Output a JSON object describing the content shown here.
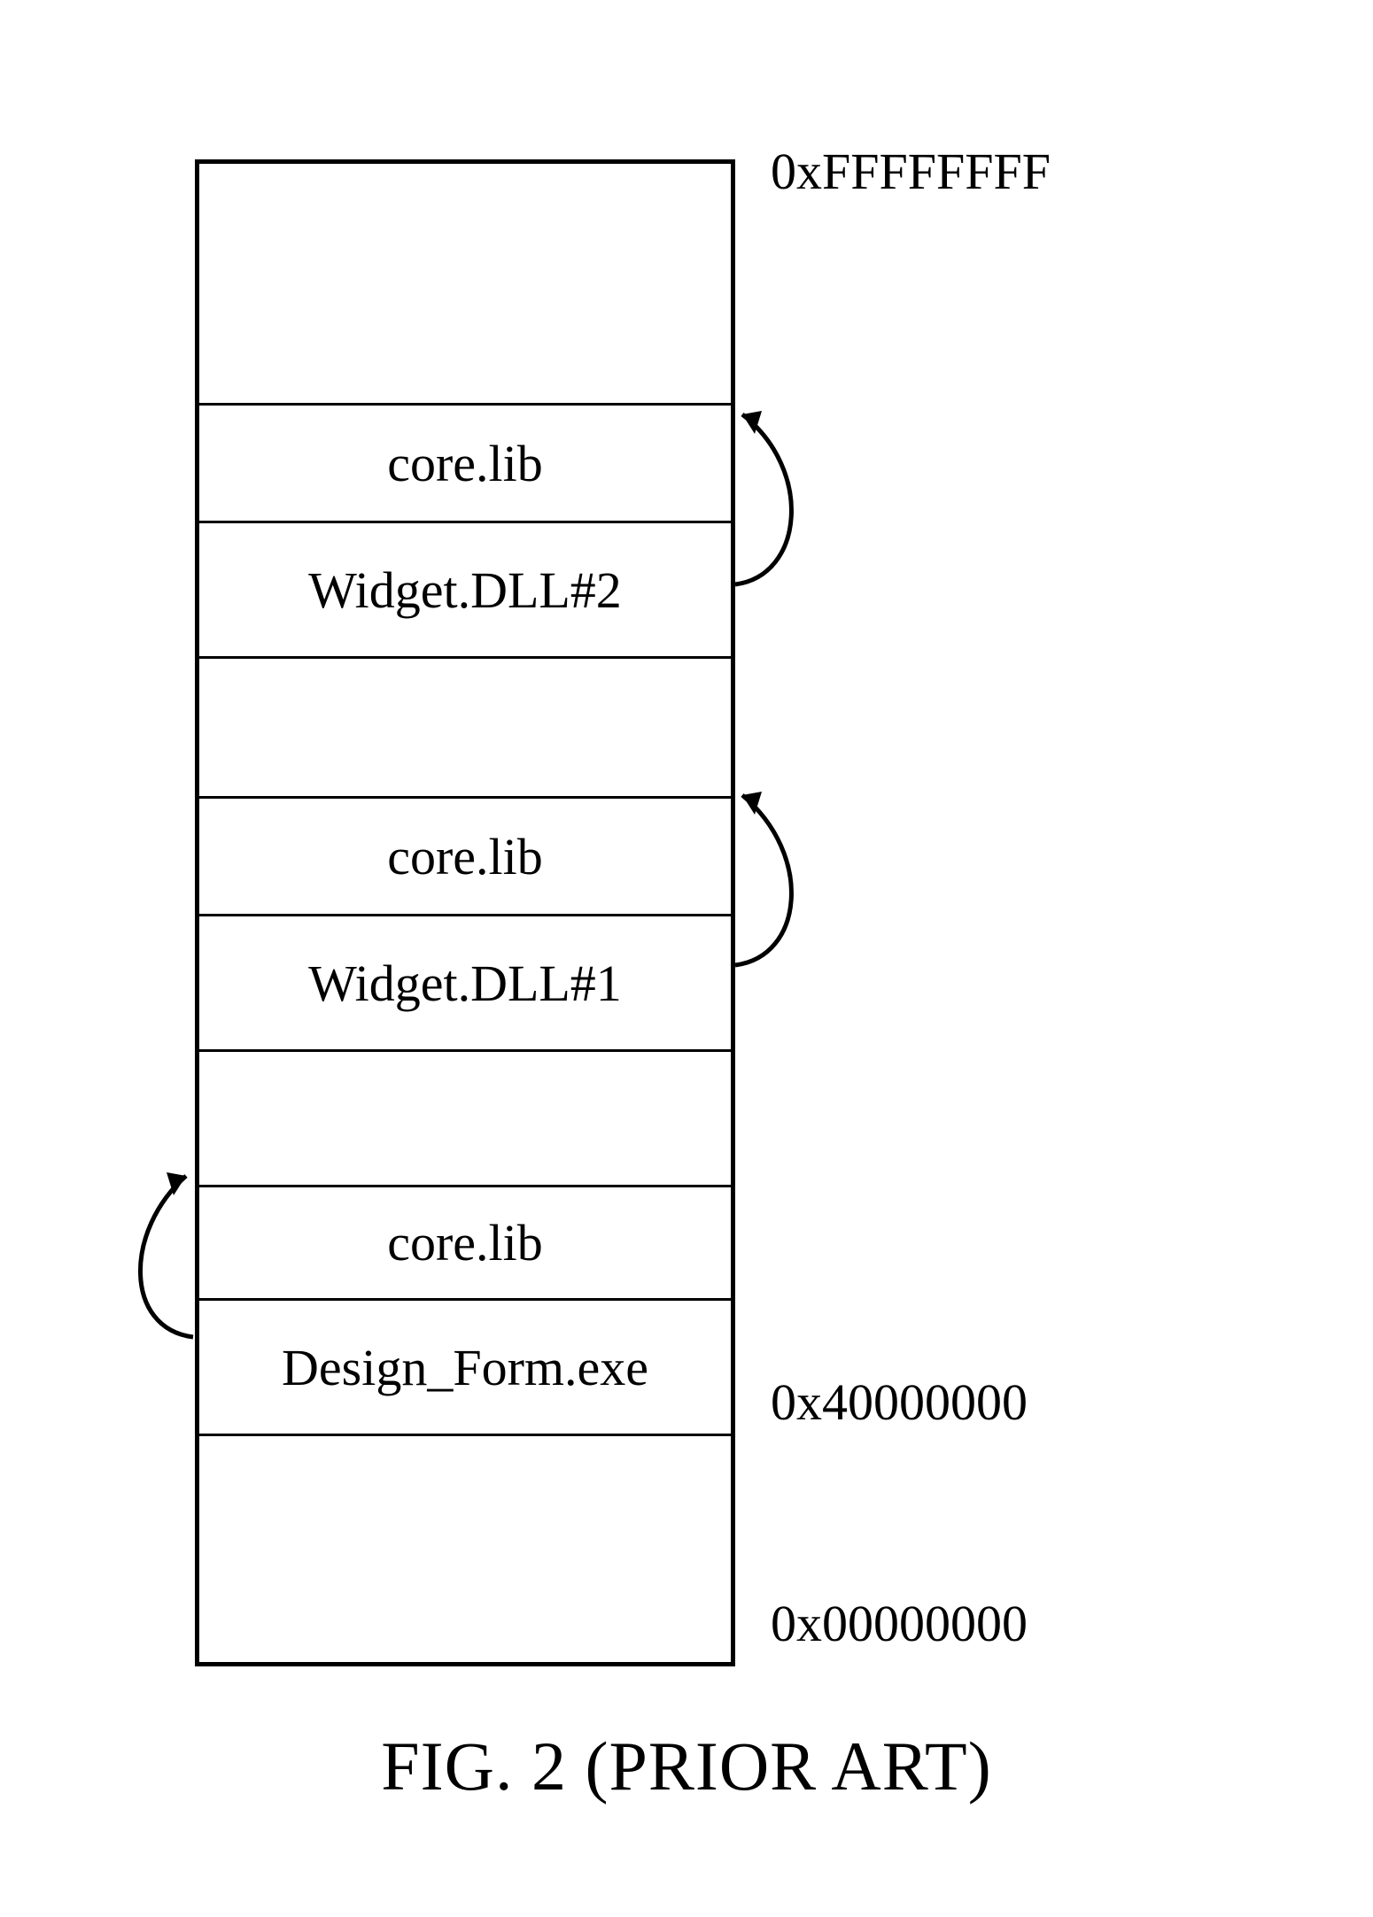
{
  "addresses": {
    "top": "0xFFFFFFFF",
    "exe_base": "0x40000000",
    "bottom": "0x00000000"
  },
  "regions": {
    "r0": "",
    "r1": "core.lib",
    "r2": "Widget.DLL#2",
    "r3": "",
    "r4": "core.lib",
    "r5": "Widget.DLL#1",
    "r6": "",
    "r7": "core.lib",
    "r8": "Design_Form.exe",
    "r9": ""
  },
  "caption": "FIG. 2 (PRIOR ART)"
}
